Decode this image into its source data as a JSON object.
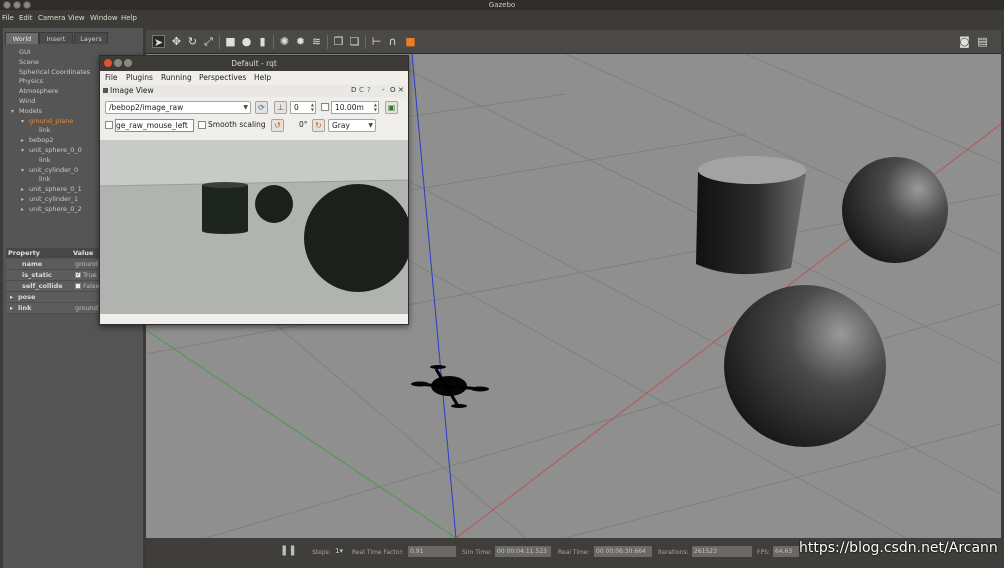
{
  "gazebo": {
    "window_title": "Gazebo",
    "menu": [
      "File",
      "Edit",
      "Camera",
      "View",
      "Window",
      "Help"
    ],
    "left_tabs": [
      "World",
      "Insert",
      "Layers"
    ],
    "tree": [
      {
        "label": "GUI",
        "indent": 0,
        "toggle": ""
      },
      {
        "label": "Scene",
        "indent": 0,
        "toggle": ""
      },
      {
        "label": "Spherical Coordinates",
        "indent": 0,
        "toggle": ""
      },
      {
        "label": "Physics",
        "indent": 0,
        "toggle": ""
      },
      {
        "label": "Atmosphere",
        "indent": 0,
        "toggle": ""
      },
      {
        "label": "Wind",
        "indent": 0,
        "toggle": ""
      },
      {
        "label": "Models",
        "indent": 0,
        "toggle": "▾"
      },
      {
        "label": "ground_plane",
        "indent": 1,
        "toggle": "▾"
      },
      {
        "label": "link",
        "indent": 2,
        "toggle": ""
      },
      {
        "label": "bebop2",
        "indent": 1,
        "toggle": "▸"
      },
      {
        "label": "unit_sphere_0_0",
        "indent": 1,
        "toggle": "▾"
      },
      {
        "label": "link",
        "indent": 2,
        "toggle": ""
      },
      {
        "label": "unit_cylinder_0",
        "indent": 1,
        "toggle": "▾"
      },
      {
        "label": "link",
        "indent": 2,
        "toggle": ""
      },
      {
        "label": "unit_sphere_0_1",
        "indent": 1,
        "toggle": "▸"
      },
      {
        "label": "unit_cylinder_1",
        "indent": 1,
        "toggle": "▸"
      },
      {
        "label": "unit_sphere_0_2",
        "indent": 1,
        "toggle": "▸"
      }
    ],
    "highlight_color": "#e8893a",
    "properties": {
      "header_key": "Property",
      "header_value": "Value",
      "rows": [
        {
          "key": "name",
          "value": "ground",
          "toggle": "",
          "check": ""
        },
        {
          "key": "is_static",
          "value": "True",
          "toggle": "",
          "check": "✓"
        },
        {
          "key": "self_collide",
          "value": "False",
          "toggle": "",
          "check": " "
        },
        {
          "key": "pose",
          "value": "",
          "toggle": "▸",
          "check": ""
        },
        {
          "key": "link",
          "value": "ground",
          "toggle": "▸",
          "check": ""
        }
      ]
    },
    "bottom": {
      "steps_label": "Steps:",
      "rtf_label": "Real Time Factor:",
      "rtf_value": "0.91",
      "sim_time_label": "Sim Time:",
      "sim_time_value": "00 00:04:11.523",
      "real_time_label": "Real Time:",
      "real_time_value": "00 00:06:30.664",
      "iterations_label": "Iterations:",
      "iterations_value": "261523",
      "fps_label": "FPS:",
      "fps_value": "64.63"
    },
    "watermark": "https://blog.csdn.net/Arcann"
  },
  "rqt": {
    "window_title": "Default - rqt",
    "menu": [
      "File",
      "Plugins",
      "Running",
      "Perspectives",
      "Help"
    ],
    "plugin_title": "Image View",
    "plugin_buttons": [
      "D",
      "C",
      "?",
      "-",
      "O",
      "✕"
    ],
    "topic": "/bebop2/image_raw",
    "rotate_value": "0",
    "range_value": "10.00m",
    "mouse_topic": "ge_raw_mouse_left",
    "smooth_scaling_label": "Smooth scaling",
    "angle_label": "0°",
    "color_scheme": "Gray"
  }
}
